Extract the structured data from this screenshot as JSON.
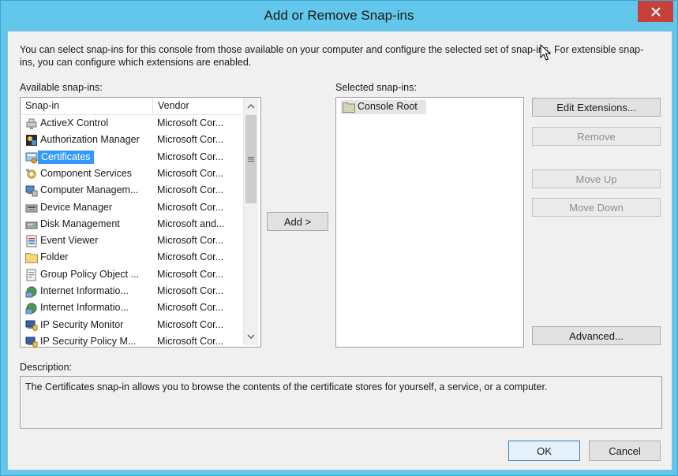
{
  "window": {
    "title": "Add or Remove Snap-ins",
    "close_glyph": "✕"
  },
  "intro_text": "You can select snap-ins for this console from those available on your computer and configure the selected set of snap-ins. For extensible snap-ins, you can configure which extensions are enabled.",
  "available": {
    "label": "Available snap-ins:",
    "columns": {
      "snapin": "Snap-in",
      "vendor": "Vendor"
    },
    "items": [
      {
        "name": "ActiveX Control",
        "vendor": "Microsoft Cor...",
        "icon": "activex-icon"
      },
      {
        "name": "Authorization Manager",
        "vendor": "Microsoft Cor...",
        "icon": "authorization-icon"
      },
      {
        "name": "Certificates",
        "vendor": "Microsoft Cor...",
        "icon": "certificates-icon",
        "selected": true
      },
      {
        "name": "Component Services",
        "vendor": "Microsoft Cor...",
        "icon": "component-services-icon"
      },
      {
        "name": "Computer Managem...",
        "vendor": "Microsoft Cor...",
        "icon": "computer-management-icon"
      },
      {
        "name": "Device Manager",
        "vendor": "Microsoft Cor...",
        "icon": "device-manager-icon"
      },
      {
        "name": "Disk Management",
        "vendor": "Microsoft and...",
        "icon": "disk-management-icon"
      },
      {
        "name": "Event Viewer",
        "vendor": "Microsoft Cor...",
        "icon": "event-viewer-icon"
      },
      {
        "name": "Folder",
        "vendor": "Microsoft Cor...",
        "icon": "folder-icon"
      },
      {
        "name": "Group Policy Object ...",
        "vendor": "Microsoft Cor...",
        "icon": "group-policy-icon"
      },
      {
        "name": "Internet Informatio...",
        "vendor": "Microsoft Cor...",
        "icon": "iis-icon"
      },
      {
        "name": "Internet Informatio...",
        "vendor": "Microsoft Cor...",
        "icon": "iis-icon"
      },
      {
        "name": "IP Security Monitor",
        "vendor": "Microsoft Cor...",
        "icon": "ip-security-icon"
      },
      {
        "name": "IP Security Policy M...",
        "vendor": "Microsoft Cor...",
        "icon": "ip-security-icon"
      }
    ]
  },
  "add_button": "Add >",
  "selected": {
    "label": "Selected snap-ins:",
    "items": [
      {
        "name": "Console Root",
        "icon": "folder-icon"
      }
    ]
  },
  "buttons": {
    "edit_extensions": "Edit Extensions...",
    "remove": "Remove",
    "move_up": "Move Up",
    "move_down": "Move Down",
    "advanced": "Advanced...",
    "ok": "OK",
    "cancel": "Cancel"
  },
  "description": {
    "label": "Description:",
    "text": "The Certificates snap-in allows you to browse the contents of the certificate stores for yourself, a service, or a computer."
  },
  "colors": {
    "title_bar": "#62c7ea",
    "close_button": "#c7403a",
    "selection": "#3399ff",
    "dialog_background": "#f0f0f0"
  }
}
